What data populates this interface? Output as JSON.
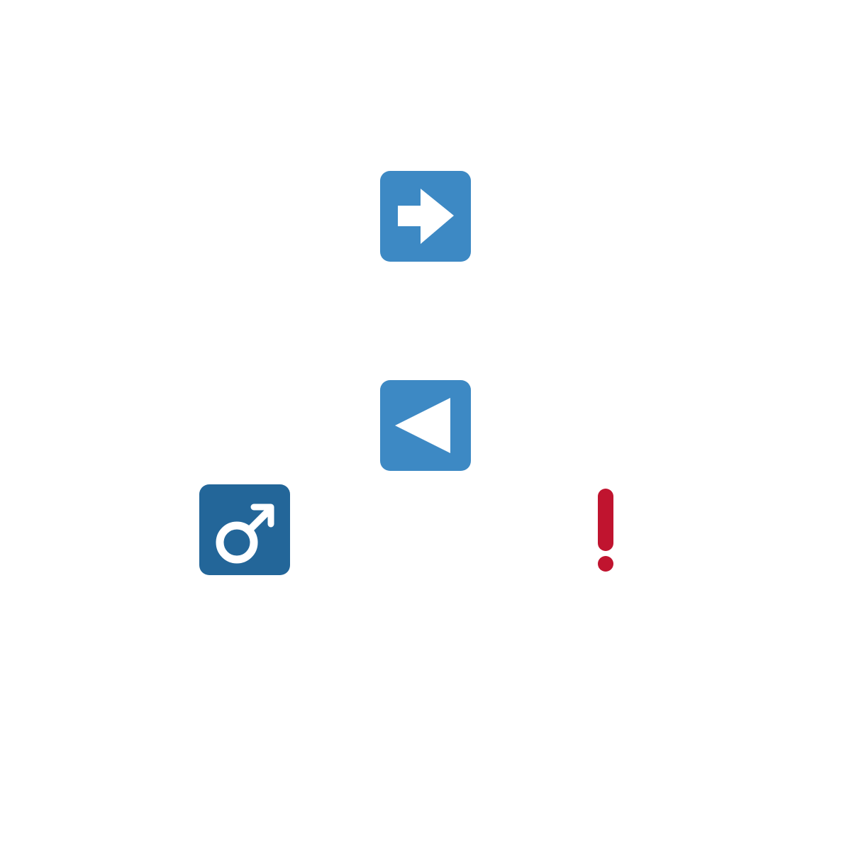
{
  "icons": [
    {
      "name": "right-arrow-icon",
      "tile_color": "#3d89c4",
      "glyph_color": "#ffffff"
    },
    {
      "name": "left-triangle-icon",
      "tile_color": "#3d89c4",
      "glyph_color": "#ffffff"
    },
    {
      "name": "male-sign-icon",
      "tile_color": "#236699",
      "glyph_color": "#ffffff"
    },
    {
      "name": "exclamation-mark-icon",
      "glyph_color": "#c0142f"
    }
  ]
}
